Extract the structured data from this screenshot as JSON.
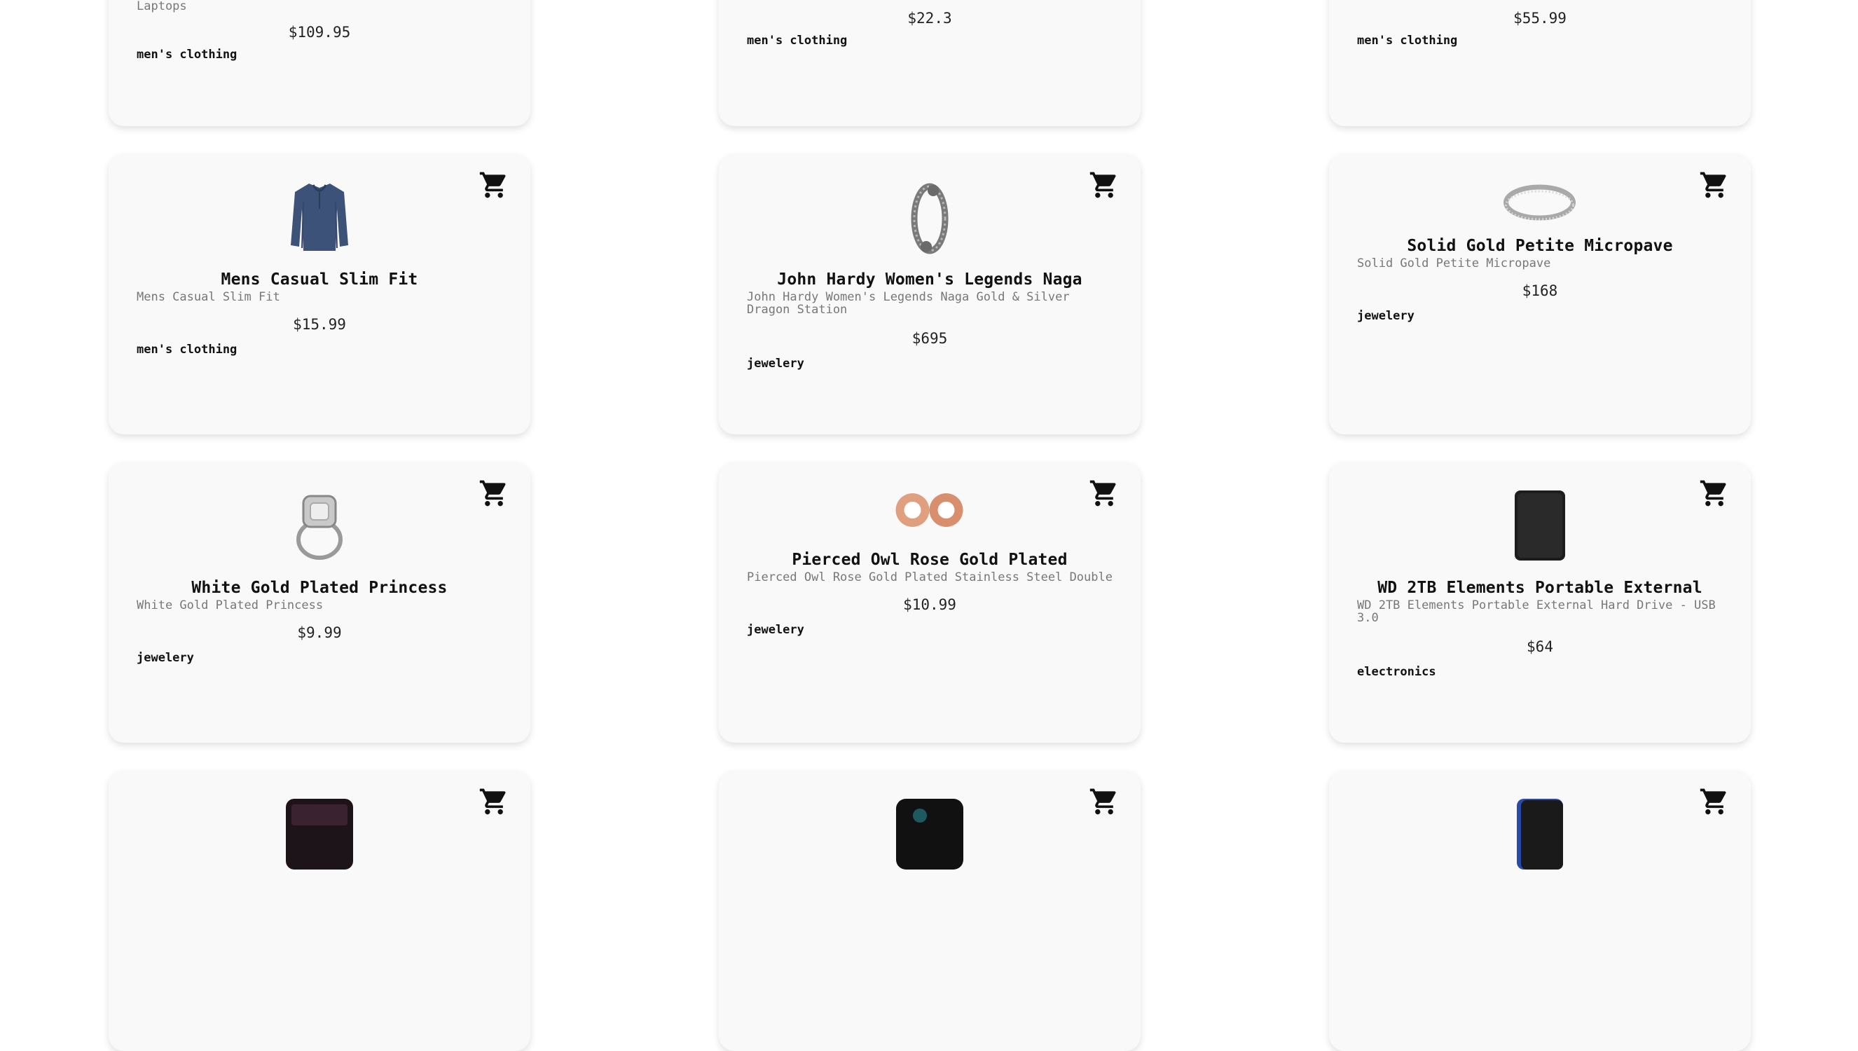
{
  "products": [
    {
      "desc": "Laptops",
      "price": "$109.95",
      "category": "men's clothing"
    },
    {
      "price": "$22.3",
      "category": "men's clothing"
    },
    {
      "price": "$55.99",
      "category": "men's clothing"
    },
    {
      "title": "Mens Casual Slim Fit",
      "desc": "Mens Casual Slim Fit",
      "price": "$15.99",
      "category": "men's clothing",
      "image": "blue-shirt-image"
    },
    {
      "title": "John Hardy Women's Legends Naga",
      "desc": "John Hardy Women's Legends Naga Gold & Silver Dragon Station",
      "price": "$695",
      "category": "jewelery",
      "image": "dragon-bracelet-image"
    },
    {
      "title": "Solid Gold Petite Micropave",
      "desc": "Solid Gold Petite Micropave",
      "price": "$168",
      "category": "jewelery",
      "image": "silver-ring-image"
    },
    {
      "title": "White Gold Plated Princess",
      "desc": "White Gold Plated Princess",
      "price": "$9.99",
      "category": "jewelery",
      "image": "diamond-ring-image"
    },
    {
      "title": "Pierced Owl Rose Gold Plated",
      "desc": "Pierced Owl Rose Gold Plated Stainless Steel Double",
      "price": "$10.99",
      "category": "jewelery",
      "image": "rose-gold-plugs-image"
    },
    {
      "title": "WD 2TB Elements Portable External",
      "desc": "WD 2TB Elements Portable External Hard Drive - USB 3.0",
      "price": "$64",
      "category": "electronics",
      "image": "hard-drive-image"
    },
    {
      "image": "ssd-plus-image"
    },
    {
      "image": "ssd-black-image"
    },
    {
      "image": "ssd-blue-image"
    }
  ],
  "icons": {
    "cart": "shopping-cart-icon"
  },
  "colors": {
    "card": "#f9f9f9",
    "text": "#111111",
    "muted": "#777777"
  }
}
